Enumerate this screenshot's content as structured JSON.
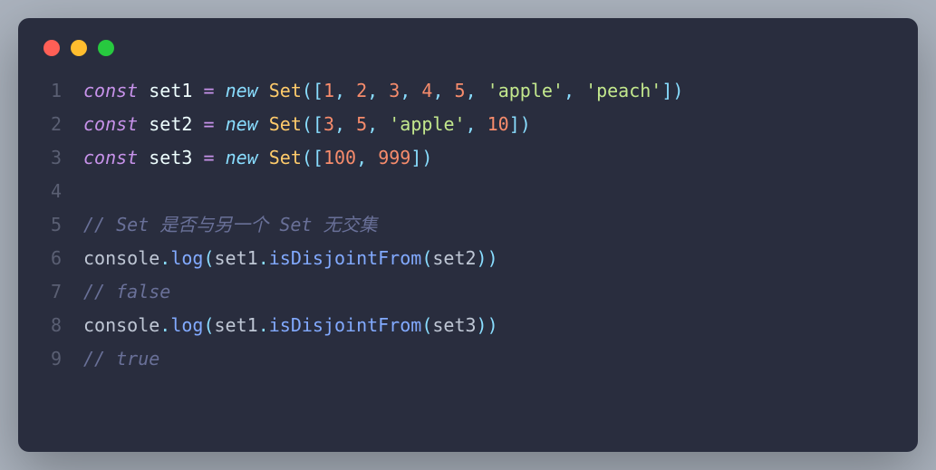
{
  "titlebar": {
    "dots": [
      "red",
      "yellow",
      "green"
    ]
  },
  "lines": [
    {
      "num": "1",
      "tokens": [
        {
          "t": "const",
          "c": "tok-keyword"
        },
        {
          "t": " ",
          "c": ""
        },
        {
          "t": "set1",
          "c": "tok-var"
        },
        {
          "t": " ",
          "c": ""
        },
        {
          "t": "=",
          "c": "tok-operator"
        },
        {
          "t": " ",
          "c": ""
        },
        {
          "t": "new",
          "c": "tok-new"
        },
        {
          "t": " ",
          "c": ""
        },
        {
          "t": "Set",
          "c": "tok-class"
        },
        {
          "t": "(",
          "c": "tok-punct"
        },
        {
          "t": "[",
          "c": "tok-punct"
        },
        {
          "t": "1",
          "c": "tok-number"
        },
        {
          "t": ",",
          "c": "tok-punct"
        },
        {
          "t": " ",
          "c": ""
        },
        {
          "t": "2",
          "c": "tok-number"
        },
        {
          "t": ",",
          "c": "tok-punct"
        },
        {
          "t": " ",
          "c": ""
        },
        {
          "t": "3",
          "c": "tok-number"
        },
        {
          "t": ",",
          "c": "tok-punct"
        },
        {
          "t": " ",
          "c": ""
        },
        {
          "t": "4",
          "c": "tok-number"
        },
        {
          "t": ",",
          "c": "tok-punct"
        },
        {
          "t": " ",
          "c": ""
        },
        {
          "t": "5",
          "c": "tok-number"
        },
        {
          "t": ",",
          "c": "tok-punct"
        },
        {
          "t": " ",
          "c": ""
        },
        {
          "t": "'apple'",
          "c": "tok-string"
        },
        {
          "t": ",",
          "c": "tok-punct"
        },
        {
          "t": " ",
          "c": ""
        },
        {
          "t": "'peach'",
          "c": "tok-string"
        },
        {
          "t": "]",
          "c": "tok-punct"
        },
        {
          "t": ")",
          "c": "tok-punct"
        }
      ]
    },
    {
      "num": "2",
      "tokens": [
        {
          "t": "const",
          "c": "tok-keyword"
        },
        {
          "t": " ",
          "c": ""
        },
        {
          "t": "set2",
          "c": "tok-var"
        },
        {
          "t": " ",
          "c": ""
        },
        {
          "t": "=",
          "c": "tok-operator"
        },
        {
          "t": " ",
          "c": ""
        },
        {
          "t": "new",
          "c": "tok-new"
        },
        {
          "t": " ",
          "c": ""
        },
        {
          "t": "Set",
          "c": "tok-class"
        },
        {
          "t": "(",
          "c": "tok-punct"
        },
        {
          "t": "[",
          "c": "tok-punct"
        },
        {
          "t": "3",
          "c": "tok-number"
        },
        {
          "t": ",",
          "c": "tok-punct"
        },
        {
          "t": " ",
          "c": ""
        },
        {
          "t": "5",
          "c": "tok-number"
        },
        {
          "t": ",",
          "c": "tok-punct"
        },
        {
          "t": " ",
          "c": ""
        },
        {
          "t": "'apple'",
          "c": "tok-string"
        },
        {
          "t": ",",
          "c": "tok-punct"
        },
        {
          "t": " ",
          "c": ""
        },
        {
          "t": "10",
          "c": "tok-number"
        },
        {
          "t": "]",
          "c": "tok-punct"
        },
        {
          "t": ")",
          "c": "tok-punct"
        }
      ]
    },
    {
      "num": "3",
      "tokens": [
        {
          "t": "const",
          "c": "tok-keyword"
        },
        {
          "t": " ",
          "c": ""
        },
        {
          "t": "set3",
          "c": "tok-var"
        },
        {
          "t": " ",
          "c": ""
        },
        {
          "t": "=",
          "c": "tok-operator"
        },
        {
          "t": " ",
          "c": ""
        },
        {
          "t": "new",
          "c": "tok-new"
        },
        {
          "t": " ",
          "c": ""
        },
        {
          "t": "Set",
          "c": "tok-class"
        },
        {
          "t": "(",
          "c": "tok-punct"
        },
        {
          "t": "[",
          "c": "tok-punct"
        },
        {
          "t": "100",
          "c": "tok-number"
        },
        {
          "t": ",",
          "c": "tok-punct"
        },
        {
          "t": " ",
          "c": ""
        },
        {
          "t": "999",
          "c": "tok-number"
        },
        {
          "t": "]",
          "c": "tok-punct"
        },
        {
          "t": ")",
          "c": "tok-punct"
        }
      ]
    },
    {
      "num": "4",
      "tokens": []
    },
    {
      "num": "5",
      "tokens": [
        {
          "t": "// Set 是否与另一个 Set 无交集",
          "c": "tok-comment"
        }
      ]
    },
    {
      "num": "6",
      "tokens": [
        {
          "t": "console",
          "c": "tok-object"
        },
        {
          "t": ".",
          "c": "tok-punct"
        },
        {
          "t": "log",
          "c": "tok-method"
        },
        {
          "t": "(",
          "c": "tok-punct"
        },
        {
          "t": "set1",
          "c": "tok-param"
        },
        {
          "t": ".",
          "c": "tok-punct"
        },
        {
          "t": "isDisjointFrom",
          "c": "tok-method"
        },
        {
          "t": "(",
          "c": "tok-punct"
        },
        {
          "t": "set2",
          "c": "tok-param"
        },
        {
          "t": ")",
          "c": "tok-punct"
        },
        {
          "t": ")",
          "c": "tok-punct"
        }
      ]
    },
    {
      "num": "7",
      "tokens": [
        {
          "t": "// false",
          "c": "tok-comment"
        }
      ]
    },
    {
      "num": "8",
      "tokens": [
        {
          "t": "console",
          "c": "tok-object"
        },
        {
          "t": ".",
          "c": "tok-punct"
        },
        {
          "t": "log",
          "c": "tok-method"
        },
        {
          "t": "(",
          "c": "tok-punct"
        },
        {
          "t": "set1",
          "c": "tok-param"
        },
        {
          "t": ".",
          "c": "tok-punct"
        },
        {
          "t": "isDisjointFrom",
          "c": "tok-method"
        },
        {
          "t": "(",
          "c": "tok-punct"
        },
        {
          "t": "set3",
          "c": "tok-param"
        },
        {
          "t": ")",
          "c": "tok-punct"
        },
        {
          "t": ")",
          "c": "tok-punct"
        }
      ]
    },
    {
      "num": "9",
      "tokens": [
        {
          "t": "// true",
          "c": "tok-comment"
        }
      ]
    }
  ]
}
